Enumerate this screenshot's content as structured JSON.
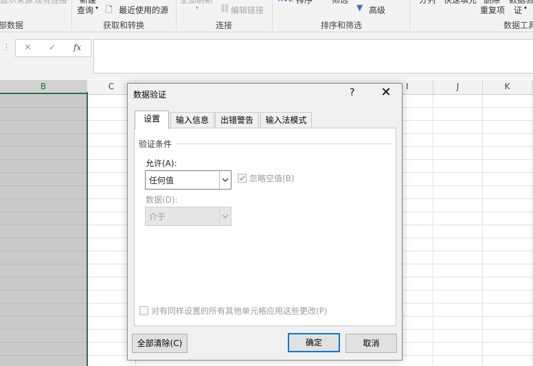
{
  "ribbon": {
    "cut_top": [
      "显示来源",
      "现有连接",
      "新建",
      "全部刷新",
      "排序",
      "筛选",
      "分列",
      "快速填充",
      "删除",
      "数据验"
    ],
    "new_query": "查询",
    "recent_sources": "最近使用的源",
    "edit_links": "编辑链接",
    "advanced": "高级",
    "remove_dup": "重复项",
    "validate": "证",
    "group_labels": [
      "获取外部数据",
      "获取和转换",
      "连接",
      "排序和筛选",
      "数据工具"
    ],
    "group_label_cut": "部数据"
  },
  "formula_bar": {
    "fx": "fx",
    "cancel": "✕",
    "enter": "✓"
  },
  "columns": [
    "B",
    "C",
    "I",
    "J",
    "K"
  ],
  "dialog": {
    "title": "数据验证",
    "help": "?",
    "close": "✕",
    "tabs": [
      "设置",
      "输入信息",
      "出错警告",
      "输入法模式"
    ],
    "section_title": "验证条件",
    "allow_label": "允许(A):",
    "allow_value": "任何值",
    "ignore_blank": "忽略空值(B)",
    "data_label": "数据(D):",
    "data_value": "介于",
    "apply_all": "对有同样设置的所有其他单元格应用这些更改(P)",
    "clear_all": "全部清除(C)",
    "ok": "确定",
    "cancel": "取消"
  }
}
